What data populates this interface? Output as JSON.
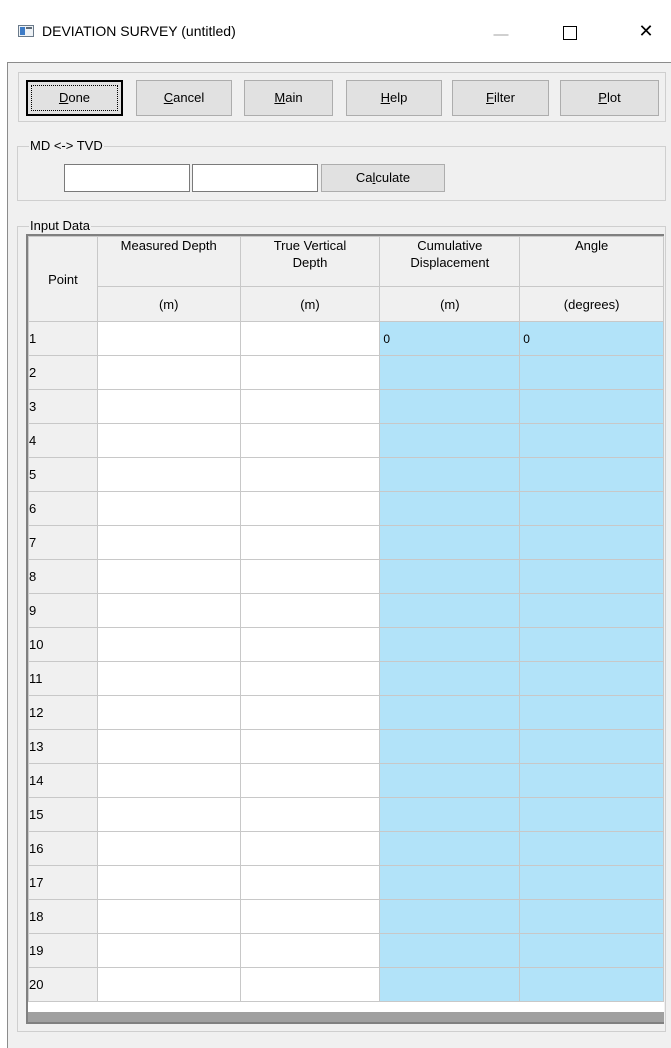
{
  "window": {
    "title": "DEVIATION SURVEY (untitled)",
    "controls": {
      "minimize": "—",
      "maximize": "☐",
      "close": "✕"
    }
  },
  "toolbar": {
    "buttons": [
      {
        "pre": "",
        "key": "D",
        "post": "one",
        "default": true
      },
      {
        "pre": "",
        "key": "C",
        "post": "ancel"
      },
      {
        "pre": "",
        "key": "M",
        "post": "ain"
      },
      {
        "pre": "",
        "key": "H",
        "post": "elp"
      },
      {
        "pre": "",
        "key": "F",
        "post": "ilter"
      },
      {
        "pre": "",
        "key": "P",
        "post": "lot"
      }
    ]
  },
  "md_tvd": {
    "label": "MD <-> TVD",
    "md_value": "",
    "tvd_value": "",
    "calculate": {
      "pre": "Ca",
      "key": "l",
      "post": "culate"
    }
  },
  "input_data": {
    "label": "Input Data",
    "point_header": "Point",
    "columns": [
      {
        "title": "Measured Depth",
        "unit": "(m)",
        "calculated": false
      },
      {
        "title": "True Vertical Depth",
        "unit": "(m)",
        "calculated": false
      },
      {
        "title": "Cumulative Displacement",
        "unit": "(m)",
        "calculated": true
      },
      {
        "title": "Angle",
        "unit": "(degrees)",
        "calculated": true
      }
    ],
    "rows": [
      {
        "point": "1",
        "md": "",
        "tvd": "",
        "disp": "0",
        "angle": "0"
      },
      {
        "point": "2",
        "md": "",
        "tvd": "",
        "disp": "",
        "angle": ""
      },
      {
        "point": "3",
        "md": "",
        "tvd": "",
        "disp": "",
        "angle": ""
      },
      {
        "point": "4",
        "md": "",
        "tvd": "",
        "disp": "",
        "angle": ""
      },
      {
        "point": "5",
        "md": "",
        "tvd": "",
        "disp": "",
        "angle": ""
      },
      {
        "point": "6",
        "md": "",
        "tvd": "",
        "disp": "",
        "angle": ""
      },
      {
        "point": "7",
        "md": "",
        "tvd": "",
        "disp": "",
        "angle": ""
      },
      {
        "point": "8",
        "md": "",
        "tvd": "",
        "disp": "",
        "angle": ""
      },
      {
        "point": "9",
        "md": "",
        "tvd": "",
        "disp": "",
        "angle": ""
      },
      {
        "point": "10",
        "md": "",
        "tvd": "",
        "disp": "",
        "angle": ""
      },
      {
        "point": "11",
        "md": "",
        "tvd": "",
        "disp": "",
        "angle": ""
      },
      {
        "point": "12",
        "md": "",
        "tvd": "",
        "disp": "",
        "angle": ""
      },
      {
        "point": "13",
        "md": "",
        "tvd": "",
        "disp": "",
        "angle": ""
      },
      {
        "point": "14",
        "md": "",
        "tvd": "",
        "disp": "",
        "angle": ""
      },
      {
        "point": "15",
        "md": "",
        "tvd": "",
        "disp": "",
        "angle": ""
      },
      {
        "point": "16",
        "md": "",
        "tvd": "",
        "disp": "",
        "angle": ""
      },
      {
        "point": "17",
        "md": "",
        "tvd": "",
        "disp": "",
        "angle": ""
      },
      {
        "point": "18",
        "md": "",
        "tvd": "",
        "disp": "",
        "angle": ""
      },
      {
        "point": "19",
        "md": "",
        "tvd": "",
        "disp": "",
        "angle": ""
      },
      {
        "point": "20",
        "md": "",
        "tvd": "",
        "disp": "",
        "angle": ""
      }
    ]
  },
  "colors": {
    "calculated_cell": "#b2e3f9",
    "dialog_face": "#f0f0f0"
  }
}
